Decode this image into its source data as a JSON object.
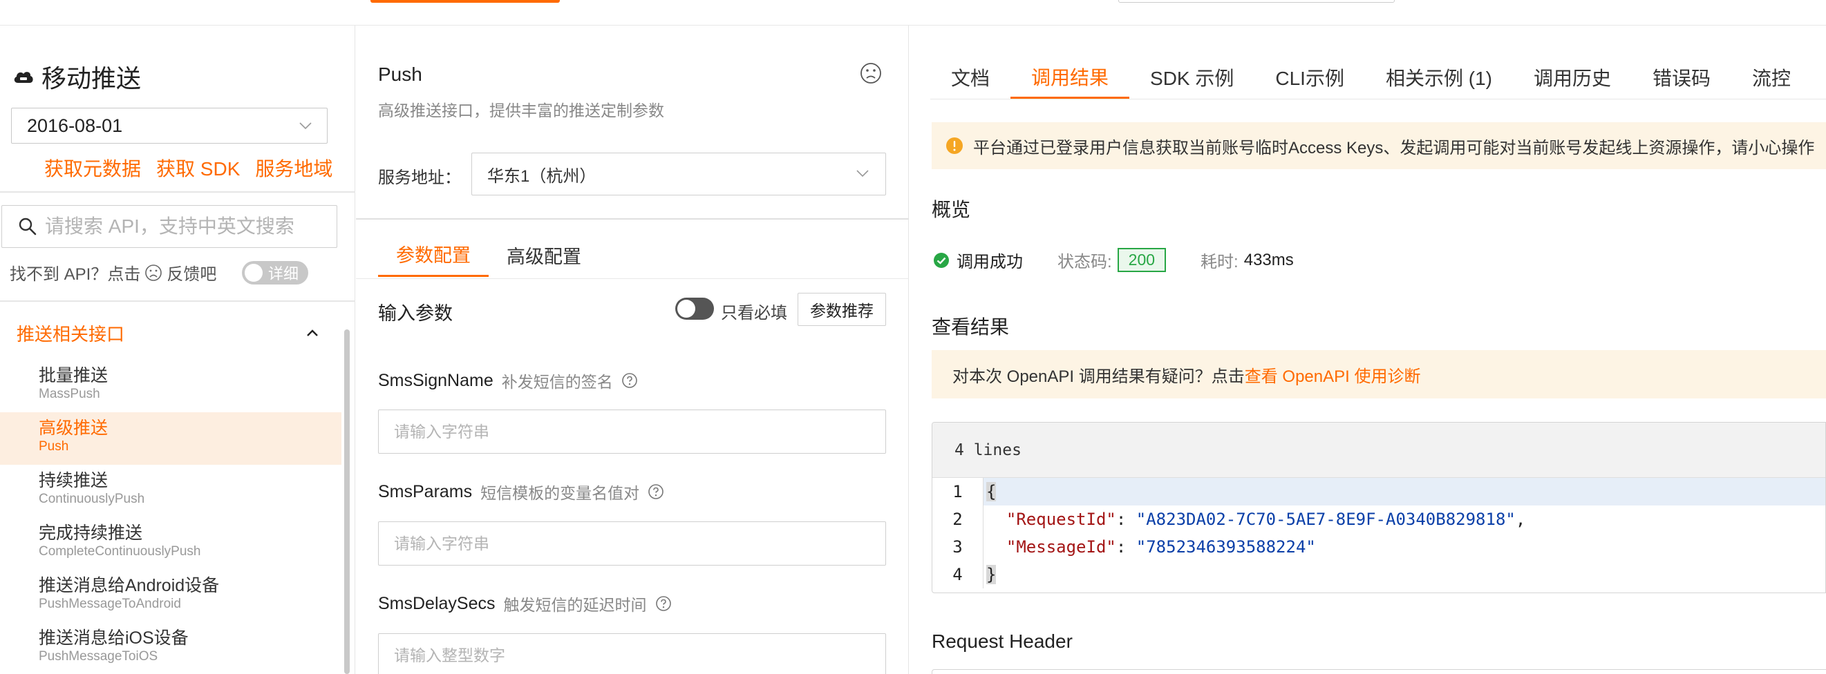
{
  "sidebar": {
    "service_title": "移动推送",
    "version": "2016-08-01",
    "links": [
      "获取元数据",
      "获取 SDK",
      "服务地域"
    ],
    "search_placeholder": "请搜索 API，支持中英文搜索",
    "notfound_prefix": "找不到 API？点击",
    "notfound_suffix": "反馈吧",
    "detail_toggle_label": "详细",
    "group_title": "推送相关接口",
    "items": [
      {
        "cn": "批量推送",
        "en": "MassPush"
      },
      {
        "cn": "高级推送",
        "en": "Push"
      },
      {
        "cn": "持续推送",
        "en": "ContinuouslyPush"
      },
      {
        "cn": "完成持续推送",
        "en": "CompleteContinuouslyPush"
      },
      {
        "cn": "推送消息给Android设备",
        "en": "PushMessageToAndroid"
      },
      {
        "cn": "推送消息给iOS设备",
        "en": "PushMessageToiOS"
      }
    ]
  },
  "middle": {
    "api_title": "Push",
    "api_desc": "高级推送接口，提供丰富的推送定制参数",
    "endpoint_label": "服务地址：",
    "endpoint_value": "华东1（杭州）",
    "tabs": [
      "参数配置",
      "高级配置"
    ],
    "input_title": "输入参数",
    "required_only_label": "只看必填",
    "recommend_button": "参数推荐",
    "params": [
      {
        "name": "SmsSignName",
        "hint": "补发短信的签名",
        "placeholder": "请输入字符串"
      },
      {
        "name": "SmsParams",
        "hint": "短信模板的变量名值对",
        "placeholder": "请输入字符串"
      },
      {
        "name": "SmsDelaySecs",
        "hint": "触发短信的延迟时间",
        "placeholder": "请输入整型数字"
      }
    ]
  },
  "right": {
    "tabs": [
      "文档",
      "调用结果",
      "SDK 示例",
      "CLI示例",
      "相关示例 (1)",
      "调用历史",
      "错误码",
      "流控"
    ],
    "warning": "平台通过已登录用户信息获取当前账号临时Access Keys、发起调用可能对当前账号发起线上资源操作，请小心操作",
    "overview_title": "概览",
    "status_text": "调用成功",
    "status_code_label": "状态码:",
    "status_code": "200",
    "duration_label": "耗时:",
    "duration": "433ms",
    "result_title": "查看结果",
    "feedback_prefix": "对本次 OpenAPI 调用结果有疑问？点击",
    "feedback_link": "查看 OpenAPI 使用诊断",
    "code_header": "4 lines",
    "code": {
      "line_numbers": [
        "1",
        "2",
        "3",
        "4"
      ],
      "open_brace": "{",
      "close_brace": "}",
      "request_id_key": "\"RequestId\"",
      "request_id_value": "\"A823DA02-7C70-5AE7-8E9F-A0340B829818\"",
      "message_id_key": "\"MessageId\"",
      "message_id_value": "\"7852346393588224\""
    },
    "request_header_title": "Request Header"
  },
  "colors": {
    "accent": "#ff6a00",
    "success": "#28a745",
    "notice_bg": "#fdf4e4"
  }
}
